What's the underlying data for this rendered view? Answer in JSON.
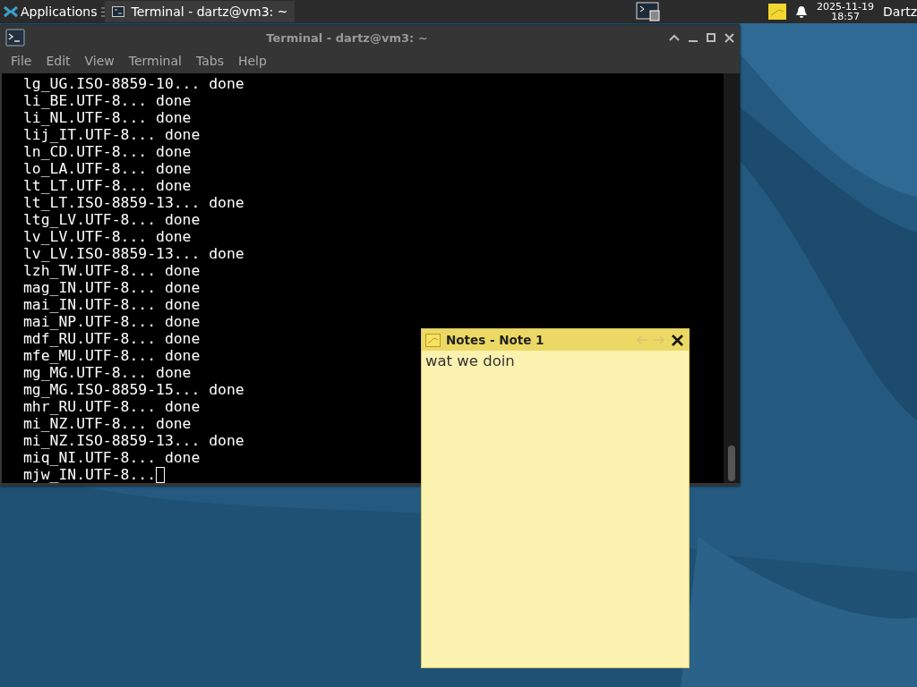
{
  "panel": {
    "applications": "Applications",
    "tasks": [
      {
        "label": "Terminal - dartz@vm3: ~",
        "selected": true
      }
    ],
    "clock": {
      "date": "2025-11-19",
      "time": "18:57"
    },
    "user": "Dartz"
  },
  "terminal": {
    "title": "Terminal - dartz@vm3: ~",
    "menu": [
      "File",
      "Edit",
      "View",
      "Terminal",
      "Tabs",
      "Help"
    ],
    "lines": [
      "lg_UG.ISO-8859-10... done",
      "li_BE.UTF-8... done",
      "li_NL.UTF-8... done",
      "lij_IT.UTF-8... done",
      "ln_CD.UTF-8... done",
      "lo_LA.UTF-8... done",
      "lt_LT.UTF-8... done",
      "lt_LT.ISO-8859-13... done",
      "ltg_LV.UTF-8... done",
      "lv_LV.UTF-8... done",
      "lv_LV.ISO-8859-13... done",
      "lzh_TW.UTF-8... done",
      "mag_IN.UTF-8... done",
      "mai_IN.UTF-8... done",
      "mai_NP.UTF-8... done",
      "mdf_RU.UTF-8... done",
      "mfe_MU.UTF-8... done",
      "mg_MG.UTF-8... done",
      "mg_MG.ISO-8859-15... done",
      "mhr_RU.UTF-8... done",
      "mi_NZ.UTF-8... done",
      "mi_NZ.ISO-8859-13... done",
      "miq_NI.UTF-8... done",
      "mjw_IN.UTF-8..."
    ]
  },
  "notes": {
    "title": "Notes - Note 1",
    "nav": [
      {
        "kind": "back",
        "disabled": true
      },
      {
        "kind": "forward",
        "disabled": true
      }
    ],
    "text": "wat we doin"
  }
}
